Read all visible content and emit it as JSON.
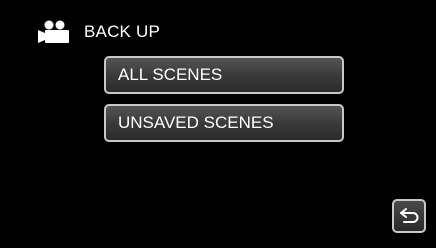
{
  "header": {
    "title": "BACK UP",
    "icon": "video-camera-icon"
  },
  "menu": {
    "items": [
      {
        "label": "ALL SCENES"
      },
      {
        "label": "UNSAVED SCENES"
      }
    ]
  },
  "nav": {
    "back_icon": "return-arrow-icon"
  }
}
